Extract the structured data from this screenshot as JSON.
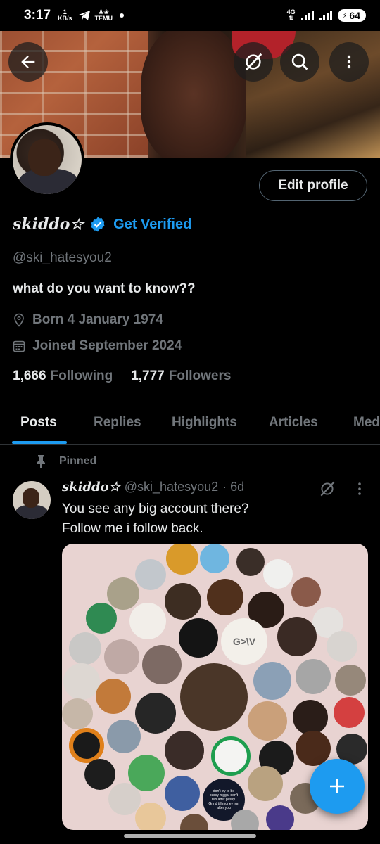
{
  "status_bar": {
    "time": "3:17",
    "data_rate_value": "1",
    "data_rate_unit": "KB/s",
    "network_type": "4G",
    "battery": "64",
    "notification_label": "TEMU"
  },
  "profile": {
    "name": "skiddo☆",
    "get_verified": "Get Verified",
    "handle": "@ski_hatesyou2",
    "bio": "what do you want to know??",
    "born": "Born 4 January 1974",
    "joined": "Joined September 2024",
    "following_count": "1,666",
    "following_label": "Following",
    "followers_count": "1,777",
    "followers_label": "Followers",
    "edit_profile": "Edit profile"
  },
  "tabs": [
    {
      "label": "Posts",
      "active": true
    },
    {
      "label": "Replies",
      "active": false
    },
    {
      "label": "Highlights",
      "active": false
    },
    {
      "label": "Articles",
      "active": false
    },
    {
      "label": "Media",
      "active": false
    }
  ],
  "pinned_post": {
    "pinned_label": "Pinned",
    "author_name": "skiddo☆",
    "author_handle": "@ski_hatesyou2",
    "age": "· 6d",
    "text_line1": "You see any big account there?",
    "text_line2": "Follow me i follow back.",
    "image_text_logo": "G>\\V",
    "image_text_meme": "don't try to be pussy nigga, don't run after pussy. Grind till money run after you"
  },
  "colors": {
    "accent": "#1d9bf0",
    "muted": "#71767b",
    "text": "#e7e9ea",
    "background": "#000000"
  },
  "icons": {
    "back": "arrow-left-icon",
    "grok": "grok-slash-icon",
    "search": "search-icon",
    "more": "more-vertical-icon",
    "location": "location-pin-icon",
    "calendar": "calendar-icon",
    "pin": "pin-icon",
    "compose": "plus-icon"
  }
}
